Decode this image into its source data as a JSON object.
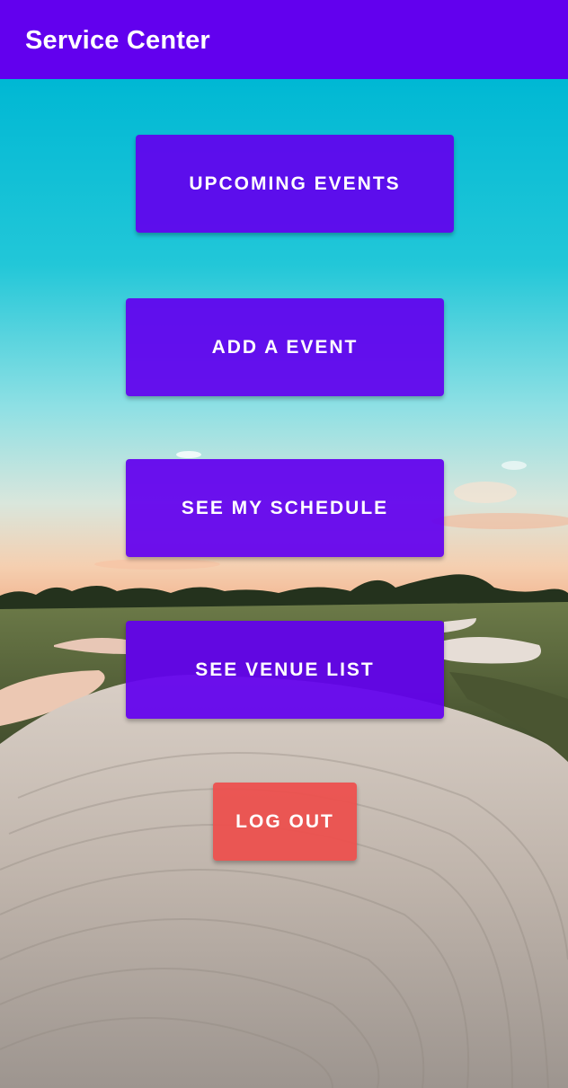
{
  "app": {
    "title": "Service Center"
  },
  "buttons": {
    "upcoming_events": "UPCOMING EVENTS",
    "add_event": "ADD A EVENT",
    "see_schedule": "SEE MY SCHEDULE",
    "see_venue_list": "SEE VENUE LIST",
    "log_out": "LOG OUT"
  },
  "colors": {
    "primary": "#6200ee",
    "danger": "#ec504e",
    "on_primary": "#ffffff"
  }
}
